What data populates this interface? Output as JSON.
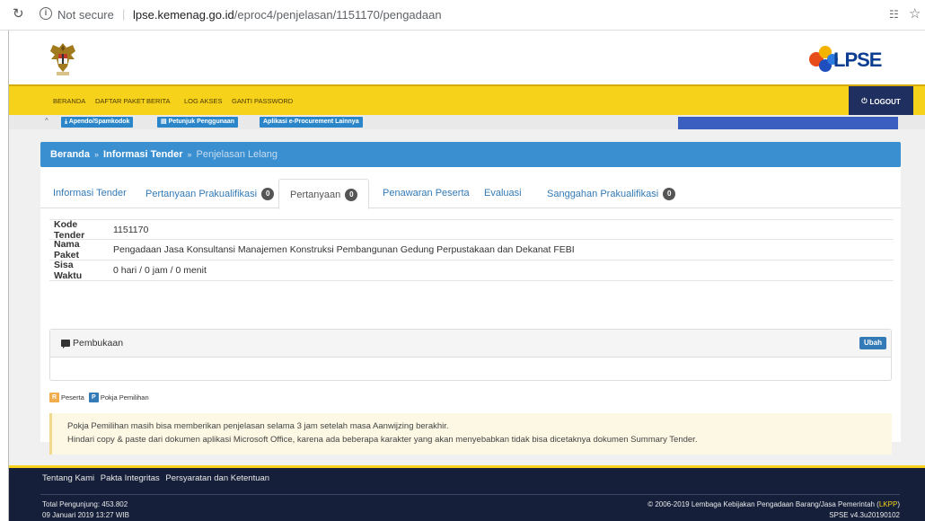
{
  "browser": {
    "not_secure": "Not secure",
    "url_host": "lpse.kemenag.go.id",
    "url_path": "/eproc4/penjelasan/1151170/pengadaan"
  },
  "header": {
    "logo_text": "LPSE"
  },
  "nav": {
    "items": [
      "BERANDA",
      "DAFTAR PAKET",
      "BERITA",
      "LOG AKSES",
      "GANTI PASSWORD"
    ],
    "logout": "LOGOUT"
  },
  "subbar": {
    "buttons": [
      "Apendo/Spamkodok",
      "Petunjuk Penggunaan",
      "Aplikasi e-Procurement Lainnya"
    ]
  },
  "breadcrumb": {
    "home": "Beranda",
    "section": "Informasi Tender",
    "current": "Penjelasan Lelang"
  },
  "tabs": [
    {
      "label": "Informasi Tender",
      "badge": null
    },
    {
      "label": "Pertanyaan Prakualifikasi",
      "badge": "0"
    },
    {
      "label": "Pertanyaan",
      "badge": "0",
      "active": true
    },
    {
      "label": "Penawaran Peserta",
      "badge": null
    },
    {
      "label": "Evaluasi",
      "badge": null
    },
    {
      "label": "Sanggahan Prakualifikasi",
      "badge": "0"
    }
  ],
  "info": {
    "kode_label": "Kode Tender",
    "kode_value": "1151170",
    "nama_label": "Nama Paket",
    "nama_value": "Pengadaan Jasa Konsultansi Manajemen Konstruksi Pembangunan Gedung Perpustakaan dan Dekanat FEBI",
    "sisa_label": "Sisa Waktu",
    "sisa_value": "0 hari / 0 jam / 0 menit"
  },
  "pembukaan": {
    "title": "Pembukaan",
    "ubah": "Ubah"
  },
  "legend": {
    "r_letter": "R",
    "r_label": "Peserta",
    "p_letter": "P",
    "p_label": "Pokja Pemilihan"
  },
  "note": {
    "line1": "Pokja Pemilihan masih bisa memberikan penjelasan selama 3 jam setelah masa Aanwijzing berakhir.",
    "line2": "Hindari copy & paste dari dokumen aplikasi Microsoft Office, karena ada beberapa karakter yang akan menyebabkan tidak bisa dicetaknya dokumen Summary Tender."
  },
  "footer": {
    "links": [
      "Tentang Kami",
      "Pakta Integritas",
      "Persyaratan dan Ketentuan"
    ],
    "visits": "Total Pengunjung: 453.802",
    "datetime": "09 Januari 2019 13:27 WIB",
    "copyright_pre": "© 2006-2019 Lembaga Kebijakan Pengadaan Barang/Jasa Pemerintah (",
    "copyright_lkpp": "LKPP",
    "copyright_post": ")",
    "version": "SPSE v4.3u20190102"
  }
}
